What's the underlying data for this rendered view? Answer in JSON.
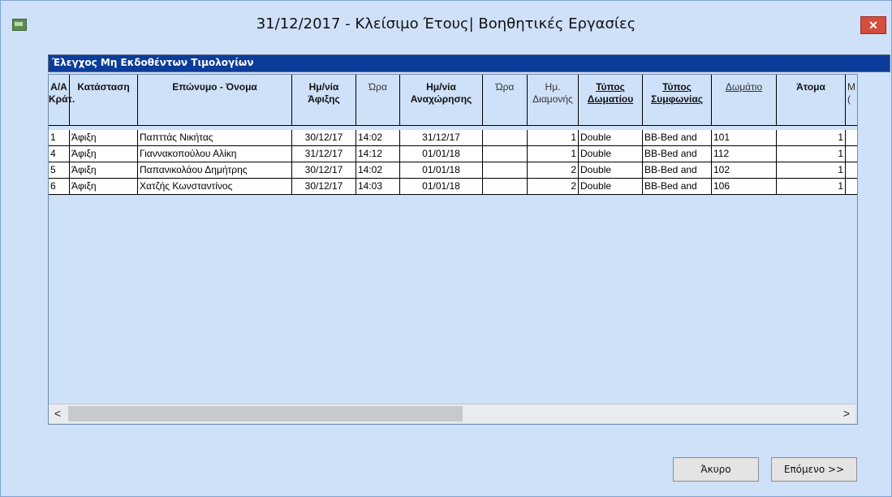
{
  "window": {
    "title": "31/12/2017 - Κλείσιμο Έτους| Βοηθητικές Εργασίες",
    "close_glyph": "✕"
  },
  "group": {
    "title": "Έλεγχος Μη Εκδοθέντων Τιμολογίων"
  },
  "table": {
    "columns": [
      {
        "label1": "Α/Α",
        "label2": "Κράτ."
      },
      {
        "label1": "Κατάσταση",
        "label2": ""
      },
      {
        "label1": "Επώνυμο - Όνομα",
        "label2": ""
      },
      {
        "label1": "Ημ/νία",
        "label2": "Άφιξης"
      },
      {
        "label1": "Ώρα",
        "label2": ""
      },
      {
        "label1": "Ημ/νία",
        "label2": "Αναχώρησης"
      },
      {
        "label1": "Ώρα",
        "label2": ""
      },
      {
        "label1": "Ημ.",
        "label2": "Διαμονής"
      },
      {
        "label1": "Τύπος",
        "label2": "Δωματίου"
      },
      {
        "label1": "Τύπος",
        "label2": "Συμφωνίας"
      },
      {
        "label1": "Δωμάτιο",
        "label2": ""
      },
      {
        "label1": "Άτομα",
        "label2": ""
      },
      {
        "label1": "Μ",
        "label2": "("
      }
    ],
    "rows": [
      [
        "1",
        "Άφιξη",
        "Παπττάς Νικήτας",
        "30/12/17",
        "14:02",
        "31/12/17",
        "",
        "1",
        "Double",
        "BB-Bed and",
        "101",
        "1"
      ],
      [
        "4",
        "Άφιξη",
        "Γιαννακοπούλου Αλίκη",
        "31/12/17",
        "14:12",
        "01/01/18",
        "",
        "1",
        "Double",
        "BB-Bed and",
        "112",
        "1"
      ],
      [
        "5",
        "Άφιξη",
        "Παπανικολάου Δημήτρης",
        "30/12/17",
        "14:02",
        "01/01/18",
        "",
        "2",
        "Double",
        "BB-Bed and",
        "102",
        "1"
      ],
      [
        "6",
        "Άφιξη",
        "Χατζής Κωνσταντίνος",
        "30/12/17",
        "14:03",
        "01/01/18",
        "",
        "2",
        "Double",
        "BB-Bed and",
        "106",
        "1"
      ]
    ]
  },
  "scrollbar": {
    "left_glyph": "<",
    "right_glyph": ">"
  },
  "buttons": {
    "cancel": "Άκυρο",
    "next": "Επόμενο >>"
  }
}
